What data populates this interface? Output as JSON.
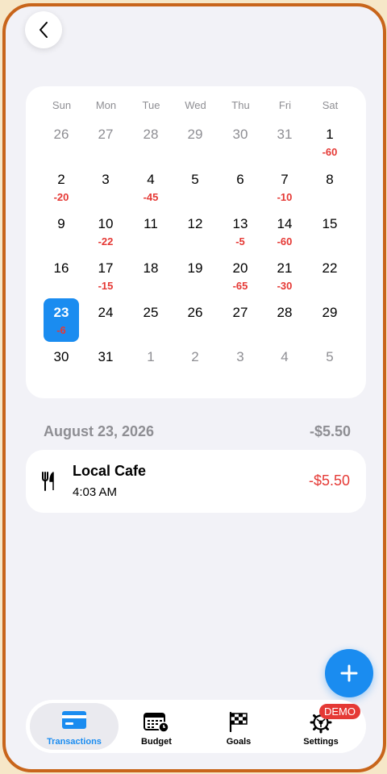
{
  "calendar": {
    "weekdays": [
      "Sun",
      "Mon",
      "Tue",
      "Wed",
      "Thu",
      "Fri",
      "Sat"
    ],
    "weeks": [
      [
        {
          "d": "26",
          "dim": true
        },
        {
          "d": "27",
          "dim": true
        },
        {
          "d": "28",
          "dim": true
        },
        {
          "d": "29",
          "dim": true
        },
        {
          "d": "30",
          "dim": true
        },
        {
          "d": "31",
          "dim": true
        },
        {
          "d": "1",
          "amt": "-60"
        }
      ],
      [
        {
          "d": "2",
          "amt": "-20"
        },
        {
          "d": "3"
        },
        {
          "d": "4",
          "amt": "-45"
        },
        {
          "d": "5"
        },
        {
          "d": "6"
        },
        {
          "d": "7",
          "amt": "-10"
        },
        {
          "d": "8"
        }
      ],
      [
        {
          "d": "9"
        },
        {
          "d": "10",
          "amt": "-22"
        },
        {
          "d": "11"
        },
        {
          "d": "12"
        },
        {
          "d": "13",
          "amt": "-5"
        },
        {
          "d": "14",
          "amt": "-60"
        },
        {
          "d": "15"
        }
      ],
      [
        {
          "d": "16"
        },
        {
          "d": "17",
          "amt": "-15"
        },
        {
          "d": "18"
        },
        {
          "d": "19"
        },
        {
          "d": "20",
          "amt": "-65"
        },
        {
          "d": "21",
          "amt": "-30"
        },
        {
          "d": "22"
        }
      ],
      [
        {
          "d": "23",
          "amt": "-6",
          "selected": true
        },
        {
          "d": "24"
        },
        {
          "d": "25"
        },
        {
          "d": "26"
        },
        {
          "d": "27"
        },
        {
          "d": "28"
        },
        {
          "d": "29"
        }
      ],
      [
        {
          "d": "30"
        },
        {
          "d": "31"
        },
        {
          "d": "1",
          "dim": true
        },
        {
          "d": "2",
          "dim": true
        },
        {
          "d": "3",
          "dim": true
        },
        {
          "d": "4",
          "dim": true
        },
        {
          "d": "5",
          "dim": true
        }
      ]
    ]
  },
  "day_summary": {
    "date": "August 23, 2026",
    "total": "-$5.50"
  },
  "transaction": {
    "name": "Local Cafe",
    "time": "4:03 AM",
    "amount": "-$5.50",
    "icon": "fork-knife-icon"
  },
  "tabs": [
    {
      "label": "Transactions",
      "icon": "credit-card-icon",
      "active": true
    },
    {
      "label": "Budget",
      "icon": "calendar-clock-icon"
    },
    {
      "label": "Goals",
      "icon": "checkered-flag-icon"
    },
    {
      "label": "Settings",
      "icon": "gear-icon"
    }
  ],
  "demo_badge": "DEMO",
  "colors": {
    "accent": "#1a8cf0",
    "negative": "#e53935",
    "frame": "#c8651b"
  }
}
